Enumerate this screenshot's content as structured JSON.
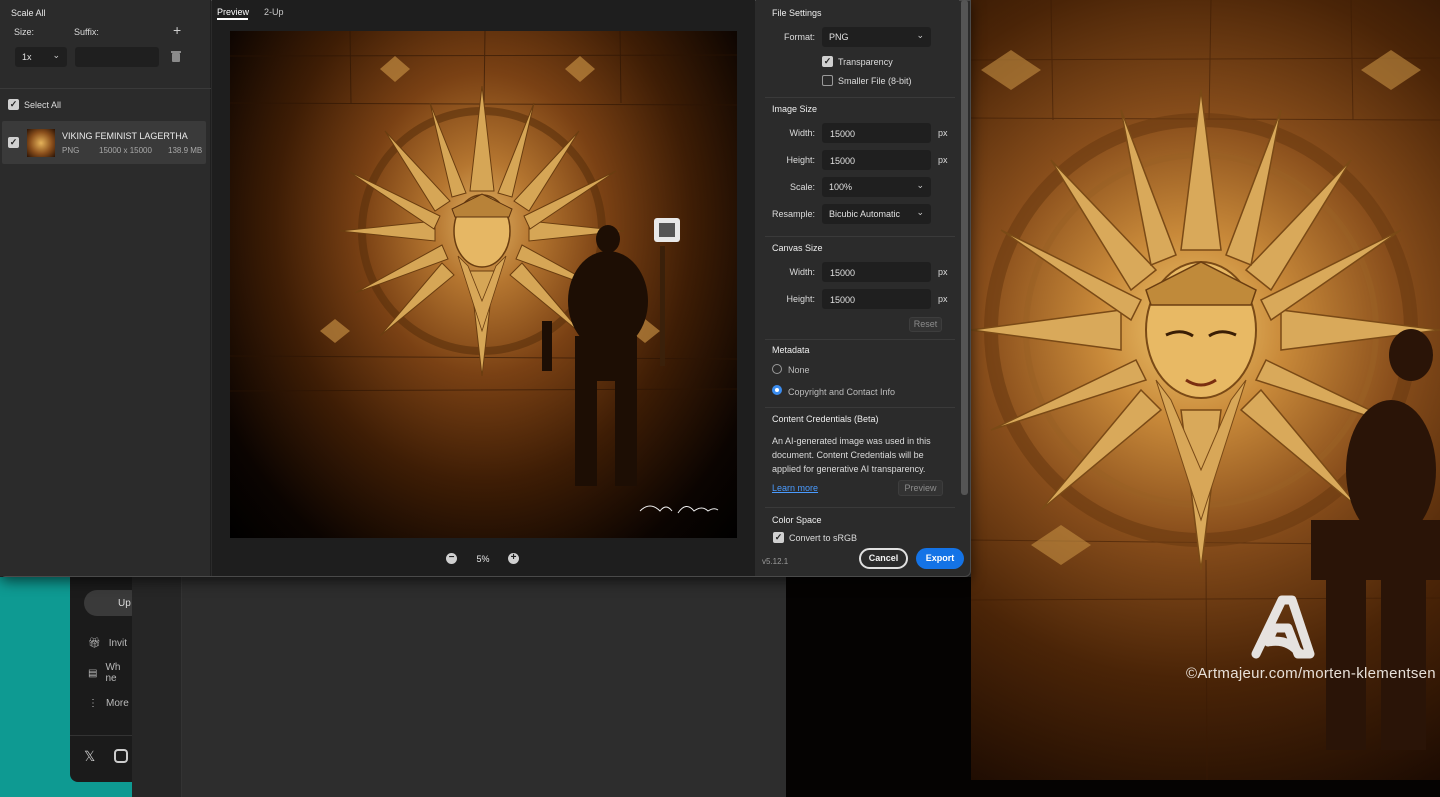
{
  "dialog": {
    "scale_all": {
      "title": "Scale All",
      "size_label": "Size:",
      "suffix_label": "Suffix:",
      "size_value": "1x",
      "suffix_value": "",
      "add_icon": "plus-icon",
      "delete_icon": "trash-icon"
    },
    "select_all_label": "Select All",
    "file": {
      "name": "VIKING FEMINIST LAGERTHA",
      "format": "PNG",
      "dimensions": "15000 x 15000",
      "size": "138.9 MB"
    },
    "tabs": [
      "Preview",
      "2-Up"
    ],
    "zoom": "5%",
    "signature": "Morten Klementsen",
    "file_settings": {
      "title": "File Settings",
      "format_label": "Format:",
      "format_value": "PNG",
      "transparency_label": "Transparency",
      "transparency_checked": true,
      "smaller_file_label": "Smaller File (8-bit)",
      "smaller_file_checked": false
    },
    "image_size": {
      "title": "Image Size",
      "width_label": "Width:",
      "width_value": "15000",
      "height_label": "Height:",
      "height_value": "15000",
      "unit": "px",
      "scale_label": "Scale:",
      "scale_value": "100%",
      "resample_label": "Resample:",
      "resample_value": "Bicubic Automatic"
    },
    "canvas_size": {
      "title": "Canvas Size",
      "width_label": "Width:",
      "width_value": "15000",
      "height_label": "Height:",
      "height_value": "15000",
      "unit": "px",
      "reset_label": "Reset"
    },
    "metadata": {
      "title": "Metadata",
      "options": [
        "None",
        "Copyright and Contact Info"
      ],
      "selected": "Copyright and Contact Info"
    },
    "content_credentials": {
      "title": "Content Credentials (Beta)",
      "text": "An AI-generated image was used in this document. Content Credentials will be applied for generative AI transparency.",
      "learn_more": "Learn more",
      "preview_label": "Preview"
    },
    "color_space": {
      "title": "Color Space",
      "convert_label": "Convert to sRGB",
      "convert_checked": true
    },
    "version": "v5.12.1",
    "cancel_label": "Cancel",
    "export_label": "Export"
  },
  "background": {
    "upload_label": "Up",
    "items": [
      "Invit",
      "Wh ne",
      "More"
    ],
    "social_icons": [
      "x-icon",
      "instagram-icon"
    ],
    "watermark": "©Artmajeur.com/morten-klementsen"
  },
  "colors": {
    "accent": "#1473e6",
    "teal": "#0e9a92"
  }
}
